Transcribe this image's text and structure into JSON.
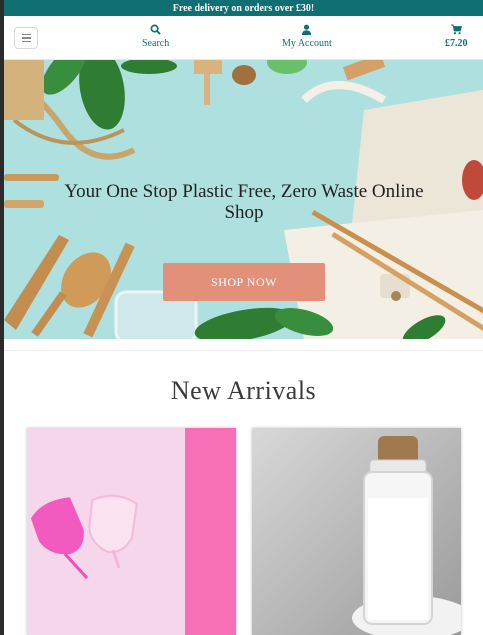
{
  "promo": {
    "text": "Free delivery on orders over £30!"
  },
  "header": {
    "search_label": "Search",
    "account_label": "My Account",
    "cart_total": "£7.20",
    "icons": {
      "menu": "hamburger-icon",
      "search": "search-icon",
      "account": "user-icon",
      "cart": "cart-icon"
    }
  },
  "hero": {
    "title": "Your One Stop Plastic Free, Zero Waste Online Shop",
    "button_label": "SHOP NOW"
  },
  "new_arrivals": {
    "title": "New Arrivals"
  },
  "colors": {
    "brand_teal": "#0f6f73",
    "hero_bg": "#aee0df",
    "button": "#e3907a"
  }
}
